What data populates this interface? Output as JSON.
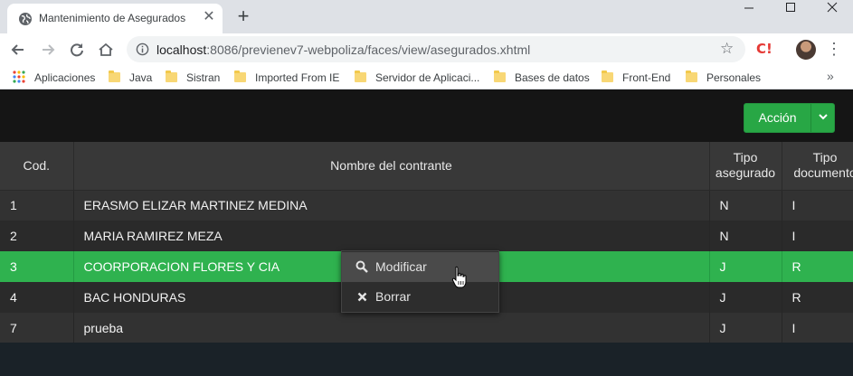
{
  "browser": {
    "tab_title": "Mantenimiento de Asegurados",
    "url_host": "localhost",
    "url_rest": ":8086/previenev7-webpoliza/faces/view/asegurados.xhtml",
    "extension_label": "C!",
    "bookmarks": [
      "Aplicaciones",
      "Java",
      "Sistran",
      "Imported From IE",
      "Servidor de Aplicaci...",
      "Bases de datos",
      "Front-End",
      "Personales"
    ],
    "more_bookmarks": "»"
  },
  "app": {
    "action_button": "Acción",
    "table": {
      "headers": {
        "cod": "Cod.",
        "nombre": "Nombre del contrante",
        "tipo_asegurado_1": "Tipo",
        "tipo_asegurado_2": "asegurado",
        "tipo_documento_1": "Tipo",
        "tipo_documento_2": "documento"
      },
      "rows": [
        {
          "cod": "1",
          "nombre": "ERASMO ELIZAR MARTINEZ MEDINA",
          "tipo_asegurado": "N",
          "tipo_documento": "I"
        },
        {
          "cod": "2",
          "nombre": "MARIA RAMIREZ MEZA",
          "tipo_asegurado": "N",
          "tipo_documento": "I"
        },
        {
          "cod": "3",
          "nombre": "COORPORACION FLORES Y CIA",
          "tipo_asegurado": "J",
          "tipo_documento": "R"
        },
        {
          "cod": "4",
          "nombre": "BAC HONDURAS",
          "tipo_asegurado": "J",
          "tipo_documento": "R"
        },
        {
          "cod": "7",
          "nombre": "prueba",
          "tipo_asegurado": "J",
          "tipo_documento": "I"
        }
      ]
    },
    "context_menu": {
      "modify": "Modificar",
      "delete": "Borrar"
    }
  },
  "colors": {
    "accent_green": "#28a745",
    "selected_row": "#2fb24f"
  }
}
